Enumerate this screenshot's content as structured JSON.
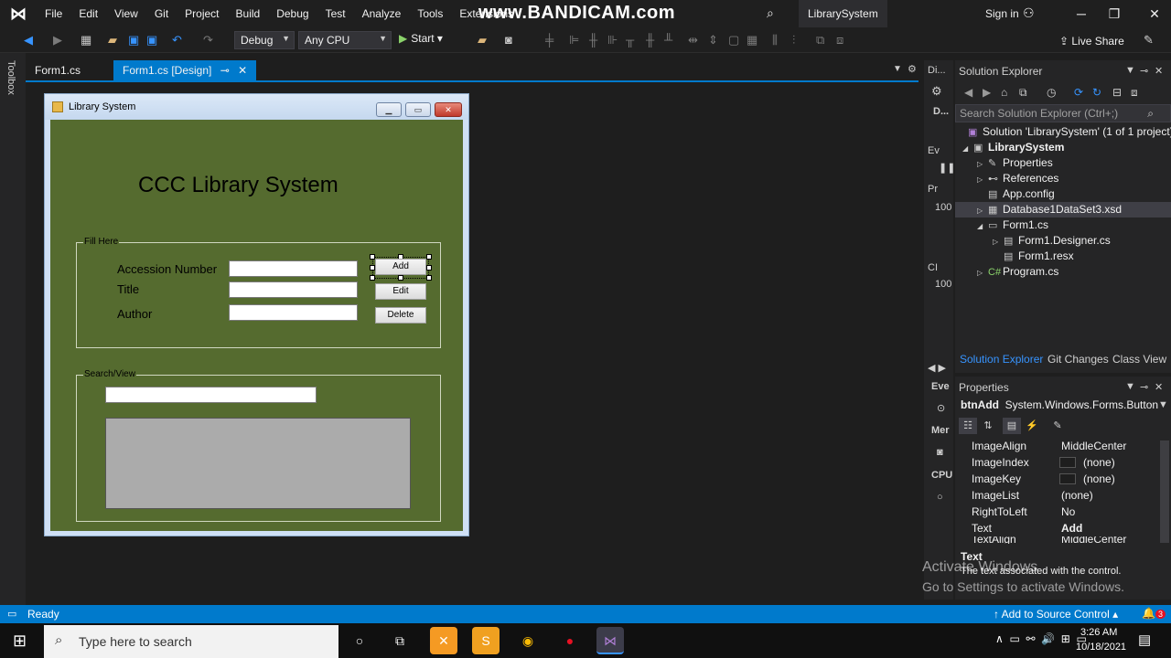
{
  "menubar": {
    "items": [
      "File",
      "Edit",
      "View",
      "Git",
      "Project",
      "Build",
      "Debug",
      "Test",
      "Analyze",
      "Tools",
      "Extensions"
    ],
    "watermark": "www.BANDICAM.com",
    "solution_name": "LibrarySystem",
    "signin": "Sign in"
  },
  "toolbar": {
    "config": "Debug",
    "platform": "Any CPU",
    "start": "Start",
    "liveshare": "Live Share"
  },
  "leftstrip": {
    "toolbox": "Toolbox"
  },
  "tabs": [
    {
      "label": "Form1.cs"
    },
    {
      "label": "Form1.cs [Design]"
    }
  ],
  "form": {
    "title": "Library System",
    "heading": "CCC Library System",
    "fill_group": "Fill Here",
    "labels": [
      "Accession Number",
      "Title",
      "Author"
    ],
    "buttons": [
      "Add",
      "Edit",
      "Delete"
    ],
    "search_group": "Search/View"
  },
  "midstrip": {
    "items": [
      "Di...",
      "D...",
      "Ev",
      "Pr",
      "100",
      "CI",
      "100",
      "Eve",
      "Mer",
      "CPU"
    ]
  },
  "solution_explorer": {
    "title": "Solution Explorer",
    "search_placeholder": "Search Solution Explorer (Ctrl+;)",
    "tree": [
      {
        "label": "Solution 'LibrarySystem' (1 of 1 project)"
      },
      {
        "label": "LibrarySystem"
      },
      {
        "label": "Properties"
      },
      {
        "label": "References"
      },
      {
        "label": "App.config"
      },
      {
        "label": "Database1DataSet3.xsd"
      },
      {
        "label": "Form1.cs"
      },
      {
        "label": "Form1.Designer.cs"
      },
      {
        "label": "Form1.resx"
      },
      {
        "label": "Program.cs"
      }
    ],
    "tabs": [
      "Solution Explorer",
      "Git Changes",
      "Class View"
    ]
  },
  "properties": {
    "title": "Properties",
    "object_name": "btnAdd",
    "object_type": "System.Windows.Forms.Button",
    "rows": [
      {
        "name": "ImageAlign",
        "value": "MiddleCenter"
      },
      {
        "name": "ImageIndex",
        "value": "(none)"
      },
      {
        "name": "ImageKey",
        "value": "(none)"
      },
      {
        "name": "ImageList",
        "value": "(none)"
      },
      {
        "name": "RightToLeft",
        "value": "No"
      },
      {
        "name": "Text",
        "value": "Add"
      },
      {
        "name": "TextAlign",
        "value": "MiddleCenter"
      }
    ],
    "desc_title": "Text",
    "desc": "The text associated with the control."
  },
  "activate": {
    "line1": "Activate Windows",
    "line2": "Go to Settings to activate Windows."
  },
  "statusbar": {
    "status": "Ready",
    "source_control": "Add to Source Control",
    "notifications": "3"
  },
  "taskbar": {
    "search_placeholder": "Type here to search",
    "time": "3:26 AM",
    "date": "10/18/2021"
  },
  "colors": {
    "accent": "#007acc",
    "form_bg": "#556b2f",
    "ide_bg": "#1e1e1e"
  }
}
